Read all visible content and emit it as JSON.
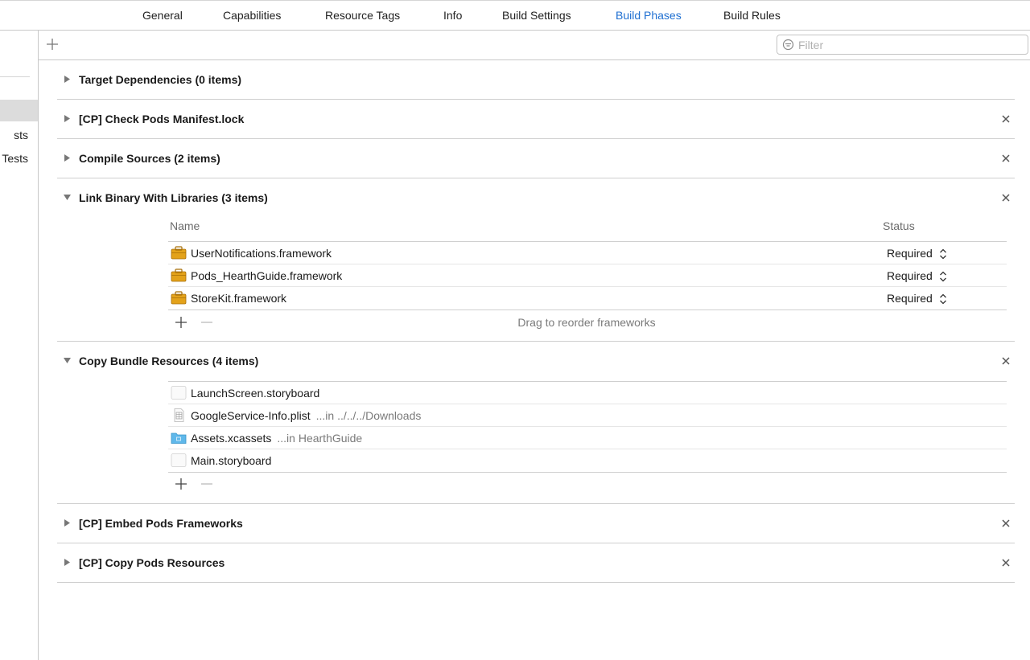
{
  "tabs": [
    {
      "label": "General"
    },
    {
      "label": "Capabilities"
    },
    {
      "label": "Resource Tags"
    },
    {
      "label": "Info"
    },
    {
      "label": "Build Settings"
    },
    {
      "label": "Build Phases",
      "active": true
    },
    {
      "label": "Build Rules"
    }
  ],
  "sidebar": {
    "items": [
      {
        "label": "sts"
      },
      {
        "label": "Tests"
      }
    ]
  },
  "toolbar": {
    "filter_placeholder": "Filter"
  },
  "phases": [
    {
      "title": "Target Dependencies (0 items)",
      "expanded": false,
      "removable": false
    },
    {
      "title": "[CP] Check Pods Manifest.lock",
      "expanded": false,
      "removable": true
    },
    {
      "title": "Compile Sources (2 items)",
      "expanded": false,
      "removable": true
    },
    {
      "title": "Link Binary With Libraries (3 items)",
      "expanded": true,
      "removable": true
    },
    {
      "title": "Copy Bundle Resources (4 items)",
      "expanded": true,
      "removable": true
    },
    {
      "title": "[CP] Embed Pods Frameworks",
      "expanded": false,
      "removable": true
    },
    {
      "title": "[CP] Copy Pods Resources",
      "expanded": false,
      "removable": true
    }
  ],
  "link_table": {
    "col_name": "Name",
    "col_status": "Status",
    "rows": [
      {
        "name": "UserNotifications.framework",
        "status": "Required",
        "icon": "framework-icon"
      },
      {
        "name": "Pods_HearthGuide.framework",
        "status": "Required",
        "icon": "framework-icon"
      },
      {
        "name": "StoreKit.framework",
        "status": "Required",
        "icon": "framework-icon"
      }
    ],
    "drag_note": "Drag to reorder frameworks"
  },
  "copy_table": {
    "rows": [
      {
        "name": "LaunchScreen.storyboard",
        "path": "",
        "icon": "storyboard-icon"
      },
      {
        "name": "GoogleService-Info.plist",
        "path": "...in ../../../Downloads",
        "icon": "plist-icon"
      },
      {
        "name": "Assets.xcassets",
        "path": "...in HearthGuide",
        "icon": "folder-icon"
      },
      {
        "name": "Main.storyboard",
        "path": "",
        "icon": "storyboard-icon"
      }
    ]
  },
  "colors": {
    "accent": "#1f6fd1",
    "separator": "#cfcfcf",
    "framework_icon": "#e3a21a",
    "folder_icon": "#5fb8ea"
  }
}
